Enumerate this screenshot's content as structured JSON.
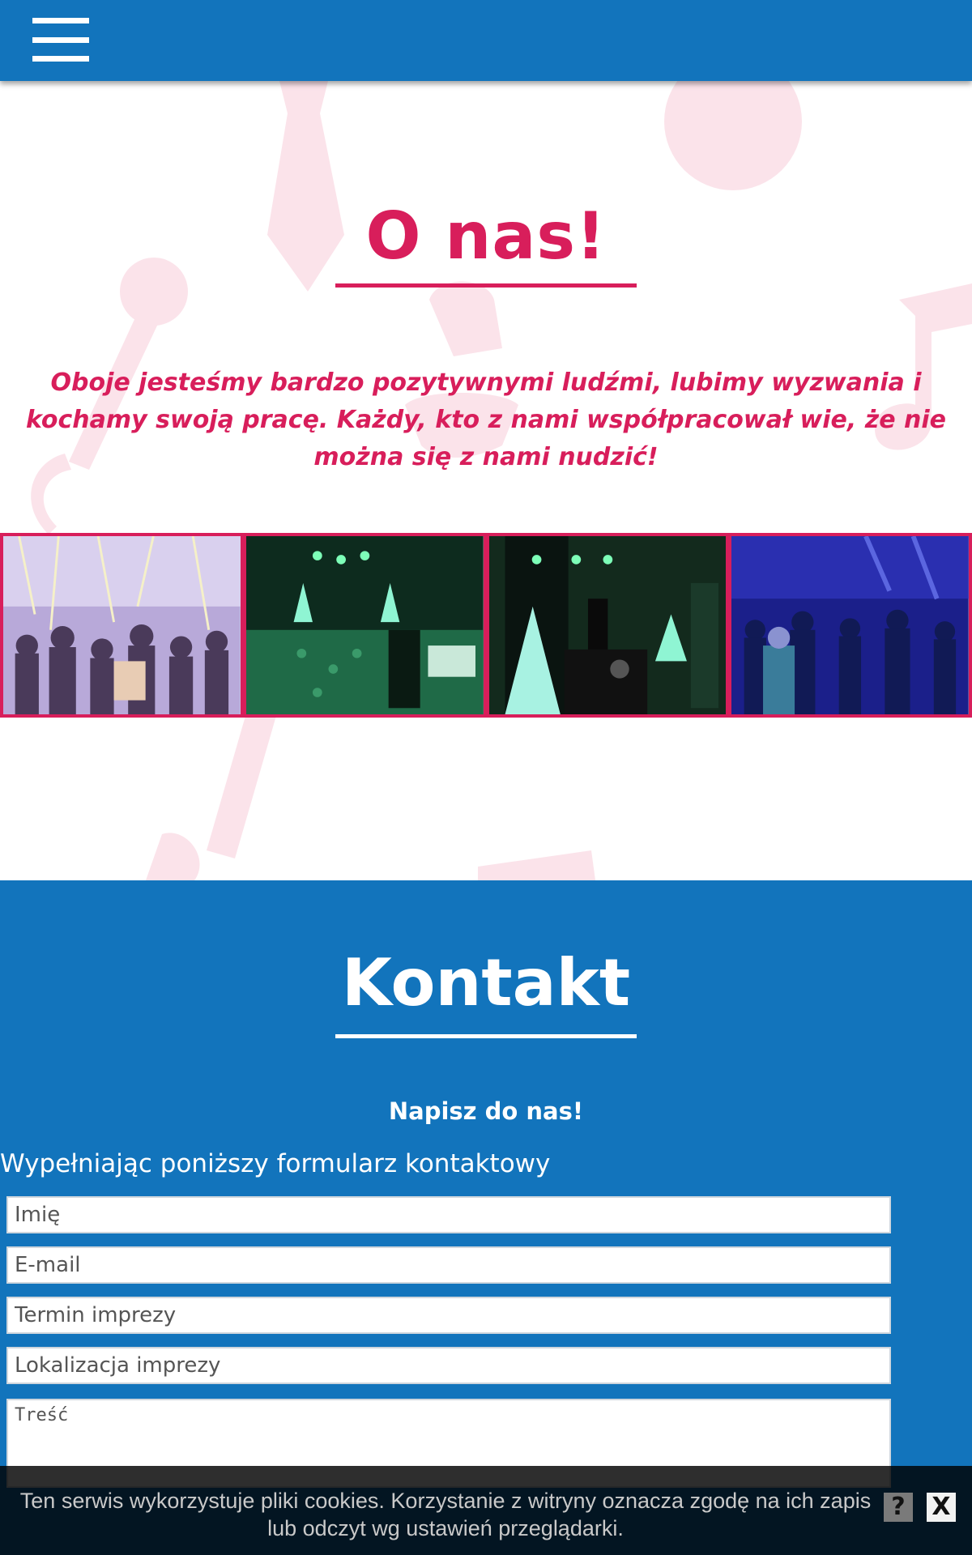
{
  "header": {
    "menu_icon": "hamburger-menu-icon",
    "background": "#1274bc"
  },
  "about": {
    "title": "O nas!",
    "text": "Oboje jesteśmy bardzo pozytywnymi ludźmi, lubimy wyzwania i kochamy swoją pracę. Każdy, kto z nami współpracował wie, że nie można się z nami nudzić!",
    "accent": "#d81e5b",
    "gallery": [
      {
        "icon": "party-dance-photo"
      },
      {
        "icon": "dj-setup-green-lights-photo"
      },
      {
        "icon": "dj-kiero-stage-photo"
      },
      {
        "icon": "dance-floor-blue-lights-photo"
      }
    ]
  },
  "contact": {
    "title": "Kontakt",
    "subtitle": "Napisz do nas!",
    "lead": "Wypełniając poniższy formularz kontaktowy",
    "fields": {
      "name_placeholder": "Imię",
      "email_placeholder": "E-mail",
      "date_placeholder": "Termin imprezy",
      "location_placeholder": "Lokalizacja imprezy",
      "message_placeholder": "Treść"
    }
  },
  "cookie": {
    "text": "Ten serwis wykorzystuje pliki cookies. Korzystanie z witryny oznacza zgodę na ich zapis lub odczyt wg ustawień przeglądarki.",
    "help_label": "?",
    "close_label": "X"
  }
}
